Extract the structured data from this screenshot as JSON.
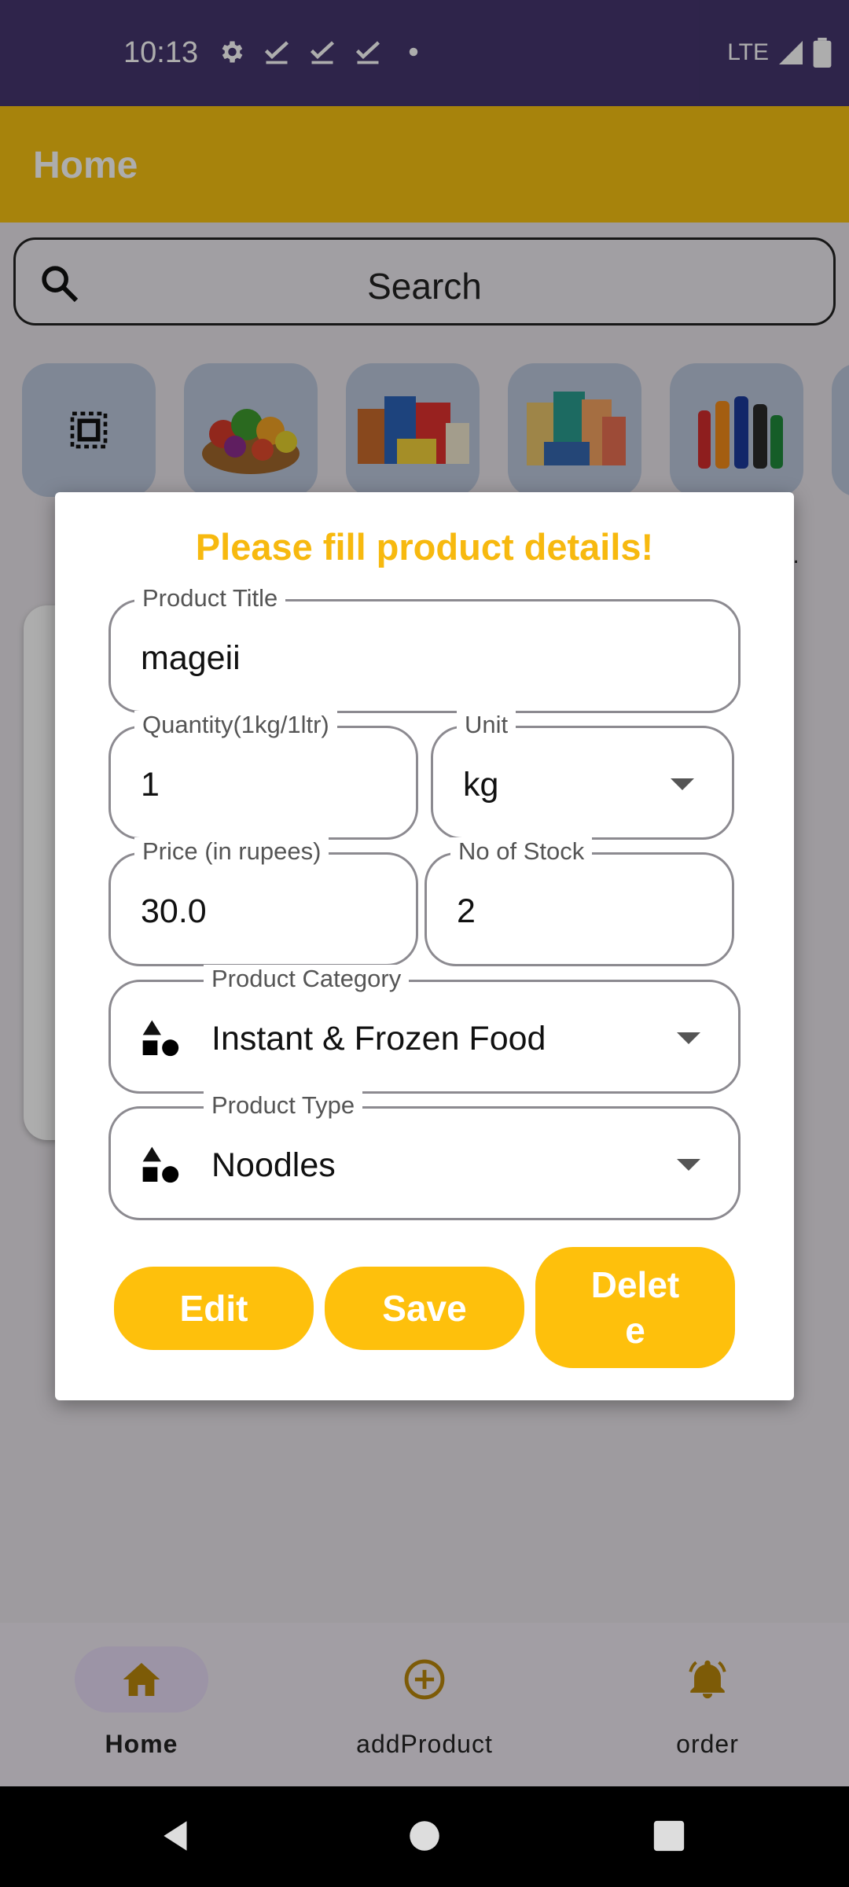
{
  "status_bar": {
    "time": "10:13",
    "network": "LTE"
  },
  "app_bar": {
    "title": "Home"
  },
  "search": {
    "placeholder": "Search"
  },
  "categories": [
    {
      "name": "all-categories"
    },
    {
      "name": "fruits-vegetables"
    },
    {
      "name": "breakfast-packaged"
    },
    {
      "name": "snacks"
    },
    {
      "name": "beverages"
    }
  ],
  "background": {
    "truncation": ".."
  },
  "dialog": {
    "heading": "Please fill product details!",
    "product_title": {
      "label": "Product Title",
      "value": "mageii"
    },
    "quantity": {
      "label": "Quantity(1kg/1ltr)",
      "value": "1"
    },
    "unit": {
      "label": "Unit",
      "value": "kg"
    },
    "price": {
      "label": "Price (in rupees)",
      "value": "30.0"
    },
    "stock": {
      "label": "No of Stock",
      "value": "2"
    },
    "category": {
      "label": "Product Category",
      "value": "Instant & Frozen Food"
    },
    "type": {
      "label": "Product Type",
      "value": "Noodles"
    },
    "buttons": {
      "edit": "Edit",
      "save": "Save",
      "delete_line1": "Delet",
      "delete_line2": "e"
    }
  },
  "bottom_nav": {
    "items": [
      {
        "label": "Home",
        "icon": "home-icon",
        "active": true
      },
      {
        "label": "addProduct",
        "icon": "add-circle-icon",
        "active": false
      },
      {
        "label": "order",
        "icon": "bell-icon",
        "active": false
      }
    ]
  },
  "colors": {
    "primary": "#f7c113",
    "button": "#fec00c",
    "status_bar": "#45356e",
    "heading": "#f7b90f"
  }
}
